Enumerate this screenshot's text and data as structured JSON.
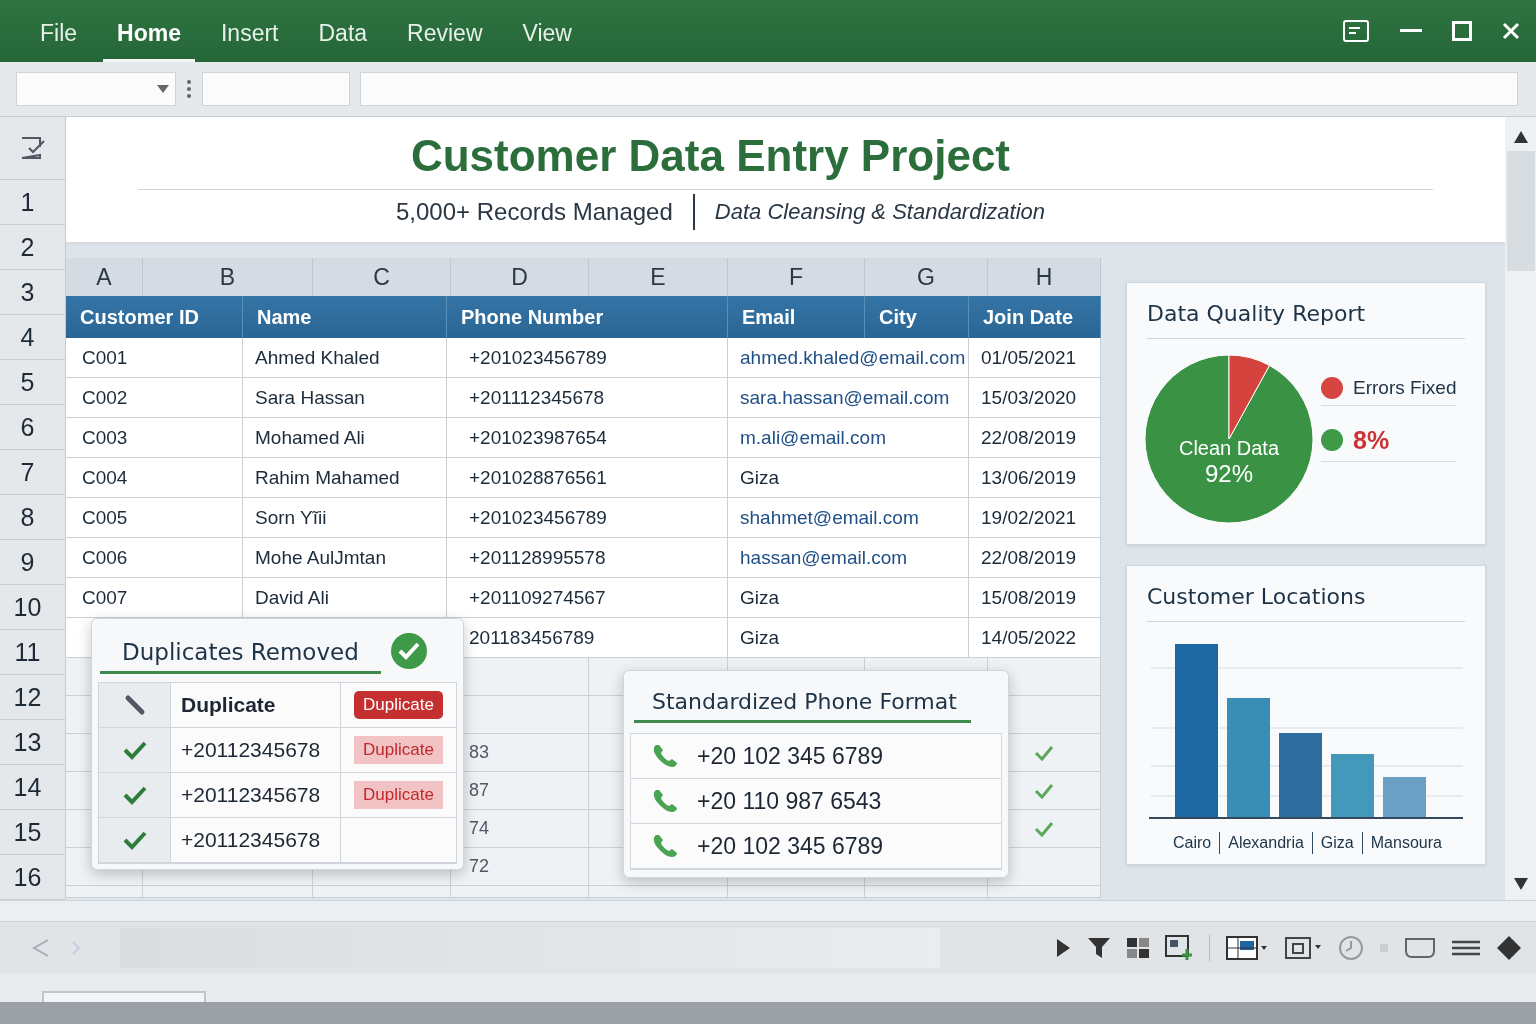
{
  "menu": {
    "tabs": [
      {
        "label": "File",
        "selected": false
      },
      {
        "label": "Home",
        "selected": true
      },
      {
        "label": "Insert",
        "selected": false
      },
      {
        "label": "Data",
        "selected": false
      },
      {
        "label": "Review",
        "selected": false
      },
      {
        "label": "View",
        "selected": false
      }
    ]
  },
  "banner": {
    "title": "Customer Data Entry Project",
    "records": "5,000+ Records Managed",
    "focus": "Data Cleansing & Standardization"
  },
  "row_numbers": [
    "1",
    "2",
    "3",
    "4",
    "5",
    "6",
    "7",
    "8",
    "9",
    "10",
    "11",
    "12",
    "13",
    "14",
    "15",
    "16"
  ],
  "columns": [
    "A",
    "B",
    "C",
    "D",
    "E",
    "F",
    "G",
    "H"
  ],
  "table": {
    "headers": [
      "Customer ID",
      "Name",
      "Phone Number",
      "Email",
      "City",
      "Join Date"
    ],
    "rows": [
      {
        "id": "C001",
        "name": "Ahmed Khaled",
        "phone": "+201023456789",
        "contact": {
          "kind": "email",
          "text": "ahmed.khaled@email.com"
        },
        "join_date": "01/05/2021"
      },
      {
        "id": "C002",
        "name": "Sara Hassan",
        "phone": "+201112345678",
        "contact": {
          "kind": "email",
          "text": "sara.hassan@email.com"
        },
        "join_date": "15/03/2020"
      },
      {
        "id": "C003",
        "name": "Mohamed Ali",
        "phone": "+201023987654",
        "contact": {
          "kind": "email",
          "text": "m.ali@email.com"
        },
        "join_date": "22/08/2019"
      },
      {
        "id": "C004",
        "name": "Rahim Mahamed",
        "phone": "+201028876561",
        "contact": {
          "kind": "city",
          "text": "Giza"
        },
        "join_date": "13/06/2019"
      },
      {
        "id": "C005",
        "name": "Sorn Yĩii",
        "phone": "+201023456789",
        "contact": {
          "kind": "email",
          "text": "shahmet@email.com"
        },
        "join_date": "19/02/2021"
      },
      {
        "id": "C006",
        "name": "Mohe AulJmtan",
        "phone": "+201128995578",
        "contact": {
          "kind": "email",
          "text": "hassan@email.com"
        },
        "join_date": "22/08/2019"
      },
      {
        "id": "C007",
        "name": "David Ali",
        "phone": "+201109274567",
        "contact": {
          "kind": "city",
          "text": "Giza"
        },
        "join_date": "15/08/2019"
      },
      {
        "phone": "201183456789",
        "contact": {
          "kind": "city",
          "text": "Giza"
        },
        "join_date": "14/05/2022"
      }
    ]
  },
  "lower_rows": [
    {
      "phone_tail": "83",
      "checked": true
    },
    {
      "phone_tail": "87",
      "checked": true
    },
    {
      "phone_tail": "74",
      "checked": true
    },
    {
      "phone_tail": "72",
      "checked": false
    }
  ],
  "duplicates": {
    "title": "Duplicates Removed",
    "header": {
      "label": "Duplicate",
      "flag": "Duplicate"
    },
    "rows": [
      {
        "number": "+20112345678",
        "checked": true,
        "flag": "Duplicate"
      },
      {
        "number": "+20112345678",
        "checked": true,
        "flag": "Duplicate"
      },
      {
        "number": "+20112345678",
        "checked": true
      }
    ]
  },
  "phone_format": {
    "title": "Standardized Phone Format",
    "numbers": [
      "+20 102 345 6789",
      "+20 110 987 6543",
      "+20 102 345 6789"
    ]
  },
  "quality": {
    "title": "Data Quality Report",
    "chart_data": {
      "type": "pie",
      "categories": [
        "Clean Data",
        "Errors Fixed"
      ],
      "values": [
        92,
        8
      ]
    },
    "slice_value": "92%",
    "legend": [
      {
        "kind": "category",
        "color": "#d6453f"
      },
      {
        "kind": "value",
        "text": "8%",
        "color": "#3f9a48"
      }
    ]
  },
  "locations": {
    "title": "Customer Locations",
    "categories": [
      "Cairo",
      "Alexandria",
      "Giza",
      "Mansoura"
    ]
  }
}
